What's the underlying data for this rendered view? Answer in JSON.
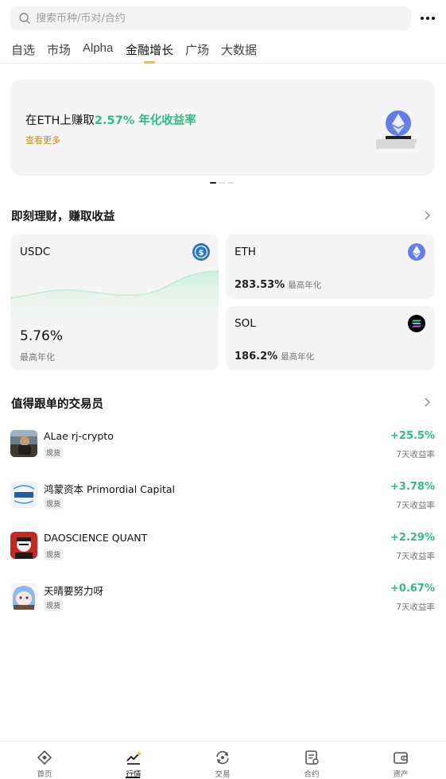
{
  "search": {
    "placeholder": "搜索币种/币对/合约"
  },
  "tabs": [
    {
      "label": "自选"
    },
    {
      "label": "市场"
    },
    {
      "label": "Alpha"
    },
    {
      "label": "金融增长"
    },
    {
      "label": "广场"
    },
    {
      "label": "大数据"
    }
  ],
  "active_tab": "金融增长",
  "banner": {
    "title_prefix": "在ETH上赚取",
    "title_highlight": "2.57% 年化收益率",
    "link": "查看更多"
  },
  "earn": {
    "title": "即刻理财，赚取收益",
    "cards": [
      {
        "name": "USDC",
        "rate": "5.76%",
        "rate_label": "最高年化",
        "icon": "usdc-icon"
      },
      {
        "name": "ETH",
        "rate": "283.53%",
        "rate_label": "最高年化",
        "icon": "eth-icon"
      },
      {
        "name": "SOL",
        "rate": "186.2%",
        "rate_label": "最高年化",
        "icon": "sol-icon"
      }
    ]
  },
  "traders": {
    "title": "值得跟单的交易员",
    "items": [
      {
        "name": "ALae rj-crypto",
        "tag": "现货",
        "roi": "+25.5%",
        "roi_label": "7天收益率"
      },
      {
        "name": "鸿蒙资本 Primordial Capital",
        "tag": "现货",
        "roi": "+3.78%",
        "roi_label": "7天收益率"
      },
      {
        "name": "DAOSCIENCE QUANT",
        "tag": "现货",
        "roi": "+2.29%",
        "roi_label": "7天收益率"
      },
      {
        "name": "天晴要努力呀",
        "tag": "现货",
        "roi": "+0.67%",
        "roi_label": "7天收益率"
      }
    ]
  },
  "bottom_nav": [
    {
      "label": "首页",
      "icon": "home-icon"
    },
    {
      "label": "行情",
      "icon": "markets-icon"
    },
    {
      "label": "交易",
      "icon": "trade-icon"
    },
    {
      "label": "合约",
      "icon": "futures-icon"
    },
    {
      "label": "资产",
      "icon": "wallet-icon"
    }
  ],
  "active_nav": "行情",
  "colors": {
    "accent": "#f5c518",
    "positive": "#2ebd85",
    "link": "#c9900a",
    "card_bg": "#f5f5f5"
  }
}
